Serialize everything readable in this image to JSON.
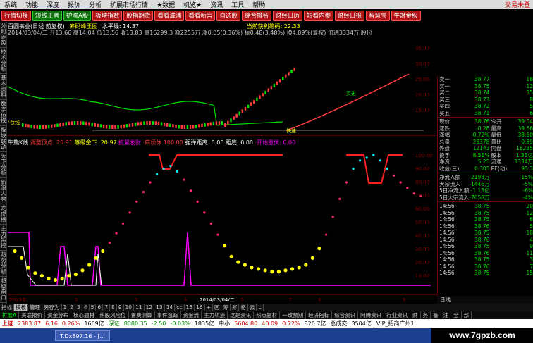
{
  "menu": {
    "items": [
      "系统",
      "功能",
      "深度",
      "报价",
      "分析",
      "扩展市场行情",
      "★数据",
      "机览★",
      "资讯",
      "工具",
      "帮助"
    ],
    "right_label": "交易未登"
  },
  "toolbar": {
    "buttons": [
      "行情切换",
      "短线王者",
      "护淘A股",
      "板块指数",
      "股指期货",
      "看看滋浦",
      "看看新宫",
      "自选股",
      "综合排名",
      "财经日历",
      "短看内参",
      "财经日报",
      "智慧宝",
      "牛財金服"
    ]
  },
  "left_tabs": [
    "分时走势",
    "技术分析",
    "基本资料",
    "数字侦探",
    "板块联动",
    "天下分析",
    "新浪人物",
    "龙虎榜",
    "主力监控",
    "趋势分析",
    "超级盘口"
  ],
  "info_line1": {
    "stock": "百圆裤业(日线 前复权)",
    "label": "筹码峰王图",
    "water_level": "水平线: 14.37",
    "profit_label": "当前获利筹码: 22.33"
  },
  "info_line2": "2014/03/04/二 开13.66 高14.04 低13.56 收13.83 量16299.3 额2255万 涨0.05(0.36%) 振0.48(3.48%) 换4.89%(复权) 流通3334万 股份",
  "info_line3": {
    "label": "牛熊K线",
    "a": "调整顶点: 20.91",
    "b": "等级金下: 20.97",
    "c": "抓紧发财",
    "d": "·麻烦休",
    "e": "100.00",
    "f": "强弹距离: 0.00",
    "g": "距底: 0.00",
    "h": "·开始涨伏: 0.00"
  },
  "chart_data": {
    "type": "line",
    "title": "",
    "price_axis_ticks": [
      35.0,
      30.0,
      25.0,
      20.0,
      15.0
    ],
    "indicator_axis_ticks": [
      100.0,
      90.0,
      80.0,
      70.0,
      60.0,
      50.0,
      40.0,
      30.0,
      20.0,
      10.0
    ],
    "x_labels": [
      "2013年",
      "2",
      "3",
      "4",
      "2014/03/04/二",
      "5",
      "7",
      "8",
      "9"
    ],
    "kline_label": "平仓线",
    "overlay_labels": [
      "快速",
      "买进"
    ],
    "dots_series": {
      "name": "dots",
      "x": [
        0,
        2,
        4,
        6,
        8,
        10,
        12,
        14,
        16,
        18,
        20,
        22,
        24,
        26,
        28,
        30,
        32,
        34,
        36,
        38,
        40,
        42,
        44,
        46,
        48,
        50,
        52,
        54,
        56,
        58,
        60,
        62,
        64,
        66,
        68,
        70,
        72,
        74,
        76,
        78,
        80,
        82,
        84,
        86,
        88,
        90,
        92,
        94,
        96,
        98,
        100,
        102,
        104,
        106,
        108,
        110,
        112,
        114,
        116,
        118,
        120
      ],
      "y": [
        30,
        25,
        18,
        14,
        12,
        10,
        9,
        10,
        12,
        13,
        16,
        20,
        25,
        30,
        36,
        43,
        50,
        58,
        66,
        73,
        80,
        86,
        90,
        92,
        88,
        82,
        74,
        66,
        58,
        50,
        42,
        34,
        26,
        22,
        20,
        18,
        17,
        16,
        15,
        15,
        16,
        17,
        18,
        20,
        25,
        32,
        42,
        55,
        68,
        80,
        90,
        96,
        98,
        100,
        96,
        90,
        85,
        80,
        76,
        72,
        70
      ]
    }
  },
  "right_panel": {
    "rows": [
      {
        "a": "卖一",
        "b": "38.77",
        "c": "",
        "d": "18"
      },
      {
        "a": "买一",
        "b": "38.75",
        "c": "",
        "d": "12"
      },
      {
        "a": "买二",
        "b": "38.74",
        "c": "",
        "d": "35"
      },
      {
        "a": "买三",
        "b": "38.73",
        "c": "",
        "d": "8"
      },
      {
        "a": "买四",
        "b": "38.72",
        "c": "",
        "d": "5"
      },
      {
        "a": "买五",
        "b": "38.71",
        "c": "",
        "d": "6"
      }
    ],
    "quote": [
      {
        "a": "现价",
        "b": "38.76",
        "c": "今开",
        "d": "39.04"
      },
      {
        "a": "涨跌",
        "b": "-0.28",
        "c": "最高",
        "d": "39.66"
      },
      {
        "a": "涨幅",
        "b": "-0.72%",
        "c": "最低",
        "d": "38.60"
      },
      {
        "a": "总量",
        "b": "28378",
        "c": "量比",
        "d": "0.89"
      },
      {
        "a": "外盘",
        "b": "12143",
        "c": "内盘",
        "d": "16235"
      },
      {
        "a": "换手",
        "b": "8.51%",
        "c": "股本",
        "d": "1.33亿"
      },
      {
        "a": "净资",
        "b": "5.25",
        "c": "流通",
        "d": "3334万"
      },
      {
        "a": "收益(三)",
        "b": "0.305",
        "c": "PE(动)",
        "d": "95.3"
      }
    ],
    "flows": [
      {
        "a": "净流入额",
        "b": "-2198万",
        "d": "-15%"
      },
      {
        "a": "大宗流入",
        "b": "-1446万",
        "d": "-5%"
      },
      {
        "a": "5日净流入额",
        "b": "-1.13亿",
        "d": "-6%"
      },
      {
        "a": "5日大宗流入",
        "b": "-7658万",
        "d": "-4%"
      }
    ],
    "ticks": [
      {
        "a": "14:56",
        "b": "38.75",
        "d": "20"
      },
      {
        "a": "14:56",
        "b": "38.75",
        "d": "12"
      },
      {
        "a": "14:56",
        "b": "38.75",
        "d": "6"
      },
      {
        "a": "14:56",
        "b": "38.76",
        "d": "5"
      },
      {
        "a": "14:56",
        "b": "38.75",
        "d": "18"
      },
      {
        "a": "14:56",
        "b": "38.76",
        "d": "4"
      },
      {
        "a": "14:56",
        "b": "38.75",
        "d": "9"
      },
      {
        "a": "14:56",
        "b": "38.76",
        "d": "11"
      },
      {
        "a": "14:56",
        "b": "38.75",
        "d": "3"
      },
      {
        "a": "14:56",
        "b": "38.76",
        "d": "7"
      },
      {
        "a": "14:56",
        "b": "38.75",
        "d": "15"
      }
    ],
    "day_tab": "日线"
  },
  "bottom_tabs": [
    "指标",
    "模板",
    "管理",
    "另存为",
    "1",
    "2",
    "3",
    "4",
    "5",
    "6",
    "7",
    "8",
    "9",
    "10",
    "11",
    "12",
    "13",
    "14",
    "cc",
    "15",
    "16",
    "+",
    "区",
    "筹",
    "筹",
    "格",
    "云",
    "L"
  ],
  "tabs2": [
    "扩展A",
    "关联报价",
    "资金分布",
    "核心题材",
    "热股风险位",
    "置费测算",
    "事件追踪",
    "资金流",
    "主力轨迹",
    "这是资讯",
    "热点题材",
    "一致预期",
    "经济指标",
    "综合资讯",
    "阿腾资讯",
    "行业资讯",
    "财",
    "务",
    "备",
    "注",
    "全",
    "部"
  ],
  "status": {
    "sh_label": "上证",
    "sh_val": "2383.87",
    "sh_chg": "6.16",
    "sh_pct": "0.26%",
    "sh_amt": "1669亿",
    "sz_label": "深证",
    "sz_val": "8080.35",
    "sz_chg": "-2.50",
    "sz_pct": "-0.03%",
    "sz_amt": "1835亿",
    "mid_label": "中小",
    "mid_val": "5604.80",
    "mid_chg": "40.09",
    "mid_pct": "0.72%",
    "mid_amt": "820.7亿",
    "total_label": "总成交",
    "total_val": "3504亿",
    "vip": "VIP_招商广州1"
  },
  "taskbar": {
    "task": "T.Dx897.16 - [..."
  },
  "watermark": "www.7gpzb.com",
  "colors": {
    "menu_bg": "#dcdcdc",
    "red_button": "#b01414",
    "price_up": "#ff3c3c",
    "price_down": "#00e000",
    "magenta_line": "#ff00ff",
    "dot_yellow": "#ffff00",
    "axis_red": "#8b0000"
  }
}
